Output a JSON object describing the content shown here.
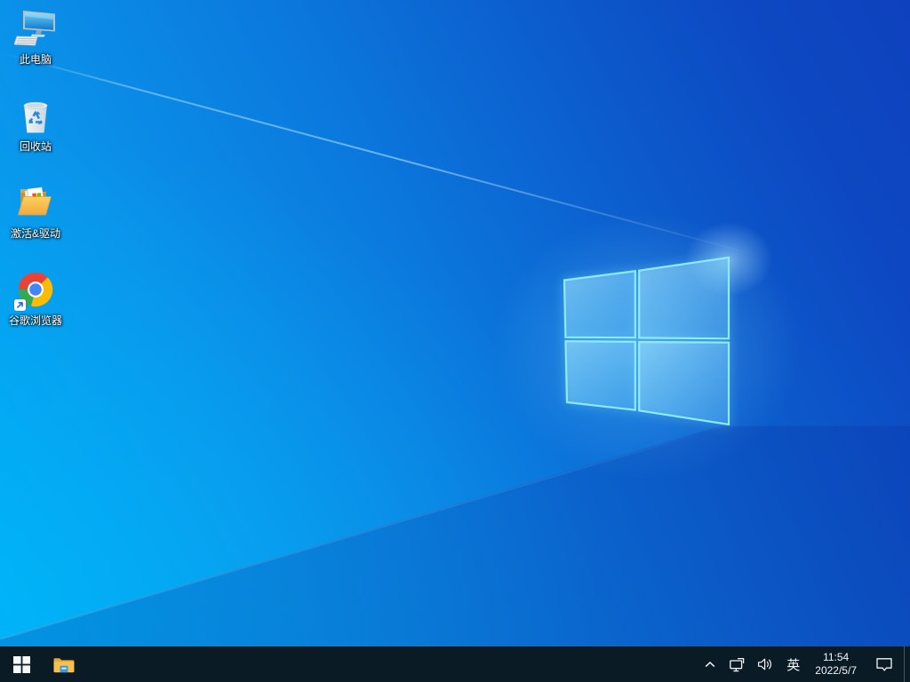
{
  "desktop": {
    "icons": [
      {
        "id": "this-pc",
        "icon": "computer-icon",
        "label": "此电脑"
      },
      {
        "id": "recycle-bin",
        "icon": "recycle-bin-icon",
        "label": "回收站"
      },
      {
        "id": "activation-drivers",
        "icon": "open-folder-icon",
        "label": "激活&驱动"
      },
      {
        "id": "google-chrome",
        "icon": "chrome-icon",
        "label": "谷歌浏览器"
      }
    ]
  },
  "taskbar": {
    "start": {
      "icon": "windows-start-icon"
    },
    "pinned": [
      {
        "icon": "file-explorer-icon"
      }
    ],
    "tray": {
      "hidden_icons": {
        "icon": "chevron-up-icon"
      },
      "network": {
        "icon": "network-ethernet-icon"
      },
      "volume": {
        "icon": "speaker-icon"
      },
      "ime_label": "英",
      "clock": {
        "time": "11:54",
        "date": "2022/5/7"
      },
      "action_center": {
        "icon": "action-center-icon"
      }
    }
  },
  "colors": {
    "taskbar_bg": "#0b1b26",
    "wallpaper_bright": "#00a9f4",
    "wallpaper_deep": "#0e41bd",
    "logo_edge": "#8debff",
    "chrome_red": "#ea4335",
    "chrome_yellow": "#fbbc05",
    "chrome_green": "#34a853",
    "chrome_blue": "#4285f4"
  }
}
